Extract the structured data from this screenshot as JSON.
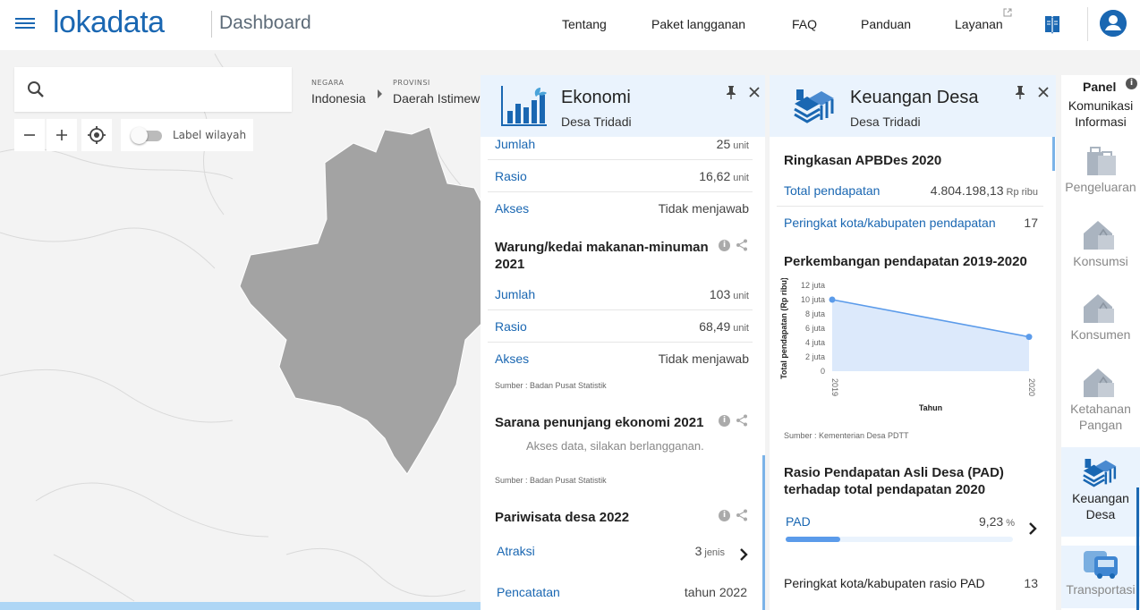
{
  "header": {
    "logo": "lokadata",
    "title": "Dashboard",
    "nav": [
      "Tentang",
      "Paket langganan",
      "FAQ",
      "Panduan",
      "Layanan"
    ]
  },
  "map": {
    "search_placeholder": "",
    "label_toggle": "Label wilayah",
    "breadcrumb": {
      "negara_label": "NEGARA",
      "negara": "Indonesia",
      "provinsi_label": "PROVINSI",
      "provinsi": "Daerah Istimew"
    }
  },
  "ekonomi": {
    "title": "Ekonomi",
    "subtitle": "Desa Tridadi",
    "top_rows": [
      {
        "label": "Jumlah",
        "value": "25",
        "unit": "unit"
      },
      {
        "label": "Rasio",
        "value": "16,62",
        "unit": "unit"
      },
      {
        "label": "Akses",
        "value": "Tidak menjawab",
        "unit": ""
      }
    ],
    "warung": {
      "title": "Warung/kedai makanan-minuman 2021",
      "rows": [
        {
          "label": "Jumlah",
          "value": "103",
          "unit": "unit"
        },
        {
          "label": "Rasio",
          "value": "68,49",
          "unit": "unit"
        },
        {
          "label": "Akses",
          "value": "Tidak menjawab",
          "unit": ""
        }
      ],
      "source": "Sumber : Badan Pusat Statistik"
    },
    "sarana": {
      "title": "Sarana penunjang ekonomi 2021",
      "note": "Akses data, silakan berlangganan.",
      "source": "Sumber : Badan Pusat Statistik"
    },
    "pariwisata": {
      "title": "Pariwisata desa 2022",
      "rows": [
        {
          "label": "Atraksi",
          "value": "3",
          "unit": "jenis"
        },
        {
          "label": "Pencatatan",
          "value": "tahun 2022",
          "unit": ""
        }
      ]
    }
  },
  "keuangan": {
    "title": "Keuangan Desa",
    "subtitle": "Desa Tridadi",
    "ringkasan": {
      "title": "Ringkasan APBDes 2020",
      "rows": [
        {
          "label": "Total pendapatan",
          "value": "4.804.198,13",
          "unit": "Rp ribu"
        },
        {
          "label": "Peringkat kota/kabupaten pendapatan",
          "value": "17",
          "unit": ""
        }
      ]
    },
    "perkembangan": {
      "title": "Perkembangan pendapatan 2019-2020",
      "source": "Sumber : Kementerian Desa PDTT"
    },
    "rasio": {
      "title": "Rasio Pendapatan Asli Desa (PAD) terhadap total pendapatan 2020",
      "pad_label": "PAD",
      "pad_value": "9,23",
      "pad_unit": "%",
      "pad_fraction": 0.0923,
      "peringkat_label": "Peringkat kota/kabupaten rasio PAD",
      "peringkat_value": "13"
    }
  },
  "chart_data": {
    "type": "area",
    "x": [
      "2019",
      "2020"
    ],
    "series": [
      {
        "values": [
          10000000,
          4800000
        ]
      }
    ],
    "xlabel": "Tahun",
    "ylabel": "Total pendapatan (Rp ribu)",
    "yticks": [
      "0",
      "2 juta",
      "4 juta",
      "6 juta",
      "8 juta",
      "10 juta",
      "12 juta"
    ],
    "ylim": [
      0,
      12000000
    ],
    "color": "#5b9bea",
    "fill": "#dce9fb"
  },
  "sidebar": {
    "title": "Panel",
    "top_item": "Komunikasi Informasi",
    "items": [
      {
        "label": "Pengeluaran",
        "icon": "shopping-bag-icon",
        "active": false
      },
      {
        "label": "Konsumsi",
        "icon": "house-basket-icon",
        "active": false
      },
      {
        "label": "Konsumen",
        "icon": "house-basket-icon",
        "active": false
      },
      {
        "label": "Ketahanan Pangan",
        "icon": "house-basket-icon",
        "active": false
      },
      {
        "label": "Keuangan Desa",
        "icon": "money-stack-icon",
        "active": true
      },
      {
        "label": "Transportasi",
        "icon": "bus-icon",
        "active": false
      }
    ]
  },
  "colors": {
    "brand": "#1a67b2",
    "panel_head": "#eaf3fd",
    "region": "#a3a3a3"
  }
}
